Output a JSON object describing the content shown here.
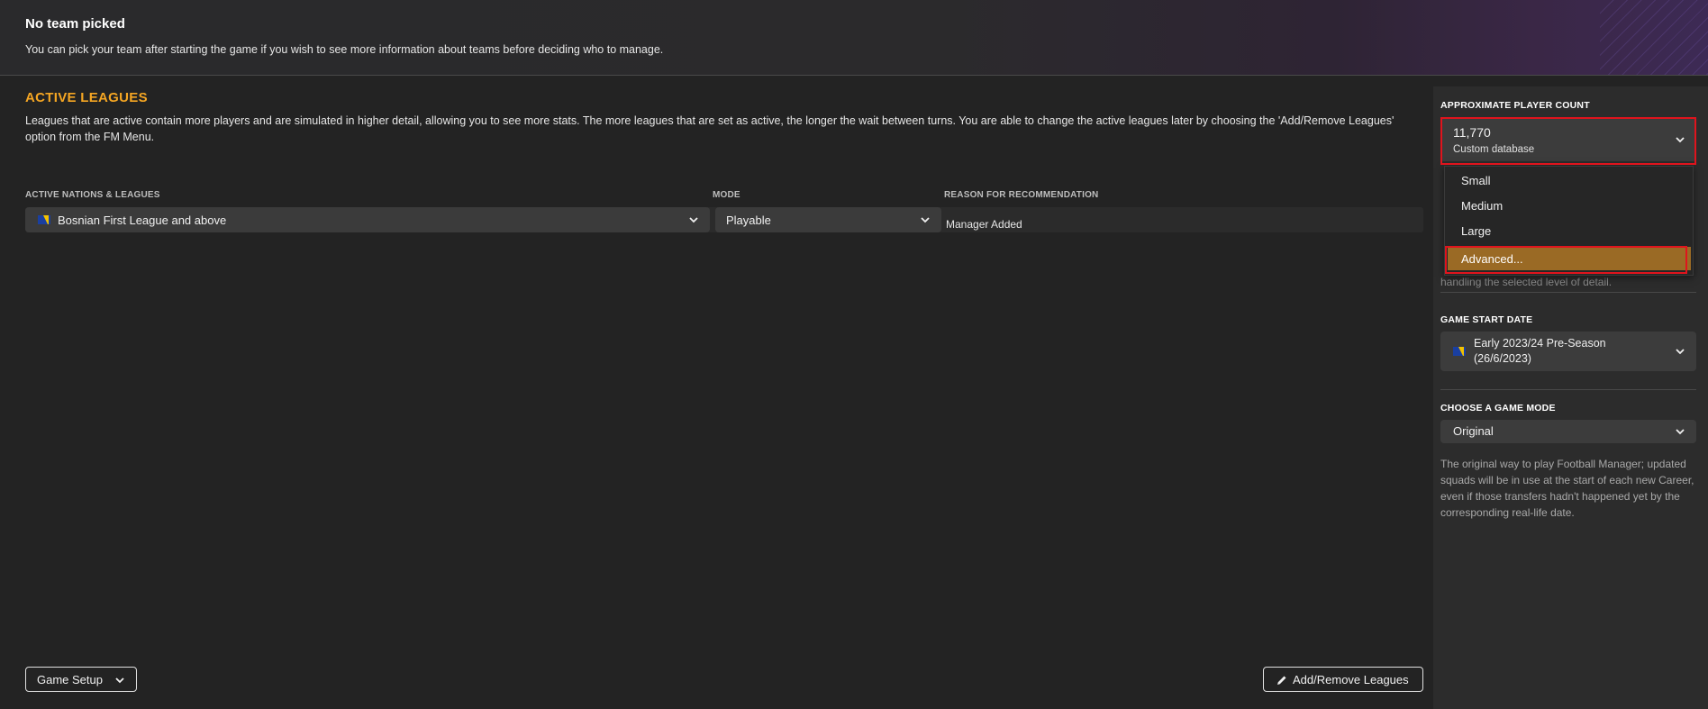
{
  "header": {
    "title": "No team picked",
    "subtitle": "You can pick your team after starting the game if you wish to see more information about teams before deciding who to manage."
  },
  "active_leagues": {
    "title": "ACTIVE LEAGUES",
    "description": "Leagues that are active contain more players and are simulated in higher detail, allowing you to see more stats. The more leagues that are set as active, the longer the wait between turns. You are able to change the active leagues later by choosing the 'Add/Remove Leagues' option from the FM Menu.",
    "columns": [
      "ACTIVE NATIONS & LEAGUES",
      "MODE",
      "REASON FOR RECOMMENDATION"
    ],
    "rows": [
      {
        "league": "Bosnian First League and above",
        "mode": "Playable",
        "reason": "Manager Added"
      }
    ]
  },
  "footer": {
    "game_setup_label": "Game Setup",
    "add_remove_label": "Add/Remove Leagues"
  },
  "sidebar": {
    "player_count": {
      "label": "APPROXIMATE PLAYER COUNT",
      "value": "11,770",
      "sub": "Custom database",
      "options": [
        "Small",
        "Medium",
        "Large",
        "Advanced..."
      ],
      "highlighted_option": "Advanced...",
      "hidden_text_fragment": "handling the selected level of detail."
    },
    "start_date": {
      "label": "GAME START DATE",
      "value_line1": "Early 2023/24 Pre-Season",
      "value_line2": "(26/6/2023)"
    },
    "game_mode": {
      "label": "CHOOSE A GAME MODE",
      "value": "Original",
      "description": "The original way to play Football Manager; updated squads will be in use at the start of each new Career, even if those transfers hadn't happened yet by the corresponding real-life date."
    }
  },
  "colors": {
    "accent_orange": "#f5a623",
    "highlight_red": "#e0141d",
    "menu_active": "#9a6a25"
  },
  "icons": [
    "chevron-down-icon",
    "pencil-icon",
    "bosnia-flag-icon"
  ]
}
